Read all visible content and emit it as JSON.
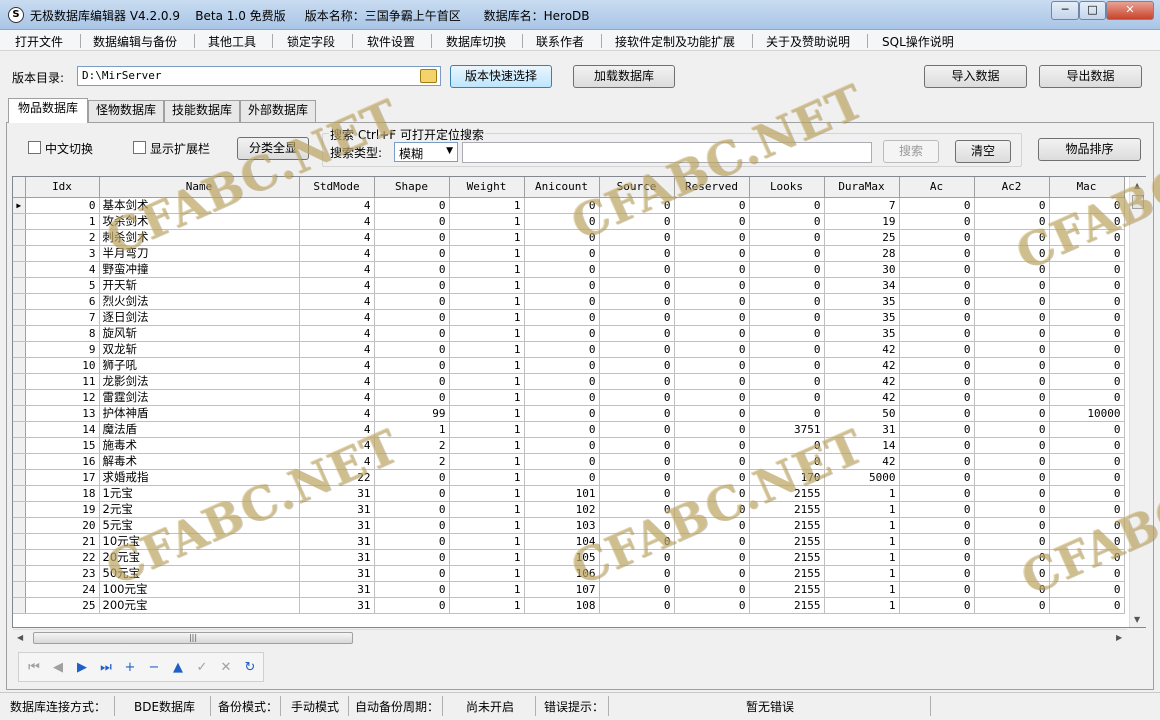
{
  "window": {
    "title": "无极数据库编辑器 V4.2.0.9    Beta 1.0 免费版     版本名称：三国争霸上午首区      数据库名：HeroDB",
    "minimize": "─",
    "maximize": "□",
    "close": "✕"
  },
  "menu": [
    "打开文件",
    "数据编辑与备份",
    "其他工具",
    "锁定字段",
    "软件设置",
    "数据库切换",
    "联系作者",
    "接软件定制及功能扩展",
    "关于及赞助说明",
    "SQL操作说明"
  ],
  "toolbar": {
    "dir_label": "版本目录:",
    "dir_value": "D:\\MirServer",
    "quick_select": "版本快速选择",
    "load_db": "加载数据库",
    "import": "导入数据",
    "export": "导出数据"
  },
  "tabs": [
    "物品数据库",
    "怪物数据库",
    "技能数据库",
    "外部数据库"
  ],
  "options": {
    "chinese_switch": "中文切换",
    "show_ext": "显示扩展栏",
    "show_all": "分类全显",
    "search_title": "搜索  Ctrl+F 可打开定位搜索",
    "search_type_label": "搜索类型:",
    "search_type_value": "模糊",
    "search_btn": "搜索",
    "clear_btn": "清空",
    "sort_btn": "物品排序"
  },
  "grid": {
    "columns": [
      "Idx",
      "Name",
      "StdMode",
      "Shape",
      "Weight",
      "Anicount",
      "Source",
      "Reserved",
      "Looks",
      "DuraMax",
      "Ac",
      "Ac2",
      "Mac"
    ],
    "rows": [
      [
        0,
        "基本剑术",
        4,
        0,
        1,
        0,
        0,
        0,
        0,
        7,
        0,
        0,
        0
      ],
      [
        1,
        "攻杀剑术",
        4,
        0,
        1,
        0,
        0,
        0,
        0,
        19,
        0,
        0,
        0
      ],
      [
        2,
        "刺杀剑术",
        4,
        0,
        1,
        0,
        0,
        0,
        0,
        25,
        0,
        0,
        0
      ],
      [
        3,
        "半月弯刀",
        4,
        0,
        1,
        0,
        0,
        0,
        0,
        28,
        0,
        0,
        0
      ],
      [
        4,
        "野蛮冲撞",
        4,
        0,
        1,
        0,
        0,
        0,
        0,
        30,
        0,
        0,
        0
      ],
      [
        5,
        "开天斩",
        4,
        0,
        1,
        0,
        0,
        0,
        0,
        34,
        0,
        0,
        0
      ],
      [
        6,
        "烈火剑法",
        4,
        0,
        1,
        0,
        0,
        0,
        0,
        35,
        0,
        0,
        0
      ],
      [
        7,
        "逐日剑法",
        4,
        0,
        1,
        0,
        0,
        0,
        0,
        35,
        0,
        0,
        0
      ],
      [
        8,
        "旋风斩",
        4,
        0,
        1,
        0,
        0,
        0,
        0,
        35,
        0,
        0,
        0
      ],
      [
        9,
        "双龙斩",
        4,
        0,
        1,
        0,
        0,
        0,
        0,
        42,
        0,
        0,
        0
      ],
      [
        10,
        "狮子吼",
        4,
        0,
        1,
        0,
        0,
        0,
        0,
        42,
        0,
        0,
        0
      ],
      [
        11,
        "龙影剑法",
        4,
        0,
        1,
        0,
        0,
        0,
        0,
        42,
        0,
        0,
        0
      ],
      [
        12,
        "雷霆剑法",
        4,
        0,
        1,
        0,
        0,
        0,
        0,
        42,
        0,
        0,
        0
      ],
      [
        13,
        "护体神盾",
        4,
        99,
        1,
        0,
        0,
        0,
        0,
        50,
        0,
        0,
        10000
      ],
      [
        14,
        "魔法盾",
        4,
        1,
        1,
        0,
        0,
        0,
        3751,
        31,
        0,
        0,
        0
      ],
      [
        15,
        "施毒术",
        4,
        2,
        1,
        0,
        0,
        0,
        0,
        14,
        0,
        0,
        0
      ],
      [
        16,
        "解毒术",
        4,
        2,
        1,
        0,
        0,
        0,
        0,
        42,
        0,
        0,
        0
      ],
      [
        17,
        "求婚戒指",
        22,
        0,
        1,
        0,
        0,
        0,
        170,
        5000,
        0,
        0,
        0
      ],
      [
        18,
        "1元宝",
        31,
        0,
        1,
        101,
        0,
        0,
        2155,
        1,
        0,
        0,
        0
      ],
      [
        19,
        "2元宝",
        31,
        0,
        1,
        102,
        0,
        0,
        2155,
        1,
        0,
        0,
        0
      ],
      [
        20,
        "5元宝",
        31,
        0,
        1,
        103,
        0,
        0,
        2155,
        1,
        0,
        0,
        0
      ],
      [
        21,
        "10元宝",
        31,
        0,
        1,
        104,
        0,
        0,
        2155,
        1,
        0,
        0,
        0
      ],
      [
        22,
        "20元宝",
        31,
        0,
        1,
        105,
        0,
        0,
        2155,
        1,
        0,
        0,
        0
      ],
      [
        23,
        "50元宝",
        31,
        0,
        1,
        106,
        0,
        0,
        2155,
        1,
        0,
        0,
        0
      ],
      [
        24,
        "100元宝",
        31,
        0,
        1,
        107,
        0,
        0,
        2155,
        1,
        0,
        0,
        0
      ],
      [
        25,
        "200元宝",
        31,
        0,
        1,
        108,
        0,
        0,
        2155,
        1,
        0,
        0,
        0
      ]
    ]
  },
  "navigator": [
    {
      "icon": "first-icon",
      "glyph": "⏮"
    },
    {
      "icon": "prior-icon",
      "glyph": "◀"
    },
    {
      "icon": "next-icon",
      "glyph": "▶"
    },
    {
      "icon": "last-icon",
      "glyph": "⏭"
    },
    {
      "icon": "insert-icon",
      "glyph": "+"
    },
    {
      "icon": "delete-icon",
      "glyph": "−"
    },
    {
      "icon": "edit-icon",
      "glyph": "▲"
    },
    {
      "icon": "post-icon",
      "glyph": "✓"
    },
    {
      "icon": "cancel-icon",
      "glyph": "✕"
    },
    {
      "icon": "refresh-icon",
      "glyph": "↻"
    }
  ],
  "status": {
    "conn_label": "数据库连接方式：",
    "conn_value": "BDE数据库",
    "backup_label": "备份模式：",
    "backup_value": "手动模式",
    "auto_label": "自动备份周期：",
    "auto_value": "尚未开启",
    "err_label": "错误提示：",
    "err_value": "暂无错误"
  },
  "watermark": "CFABC.NET"
}
